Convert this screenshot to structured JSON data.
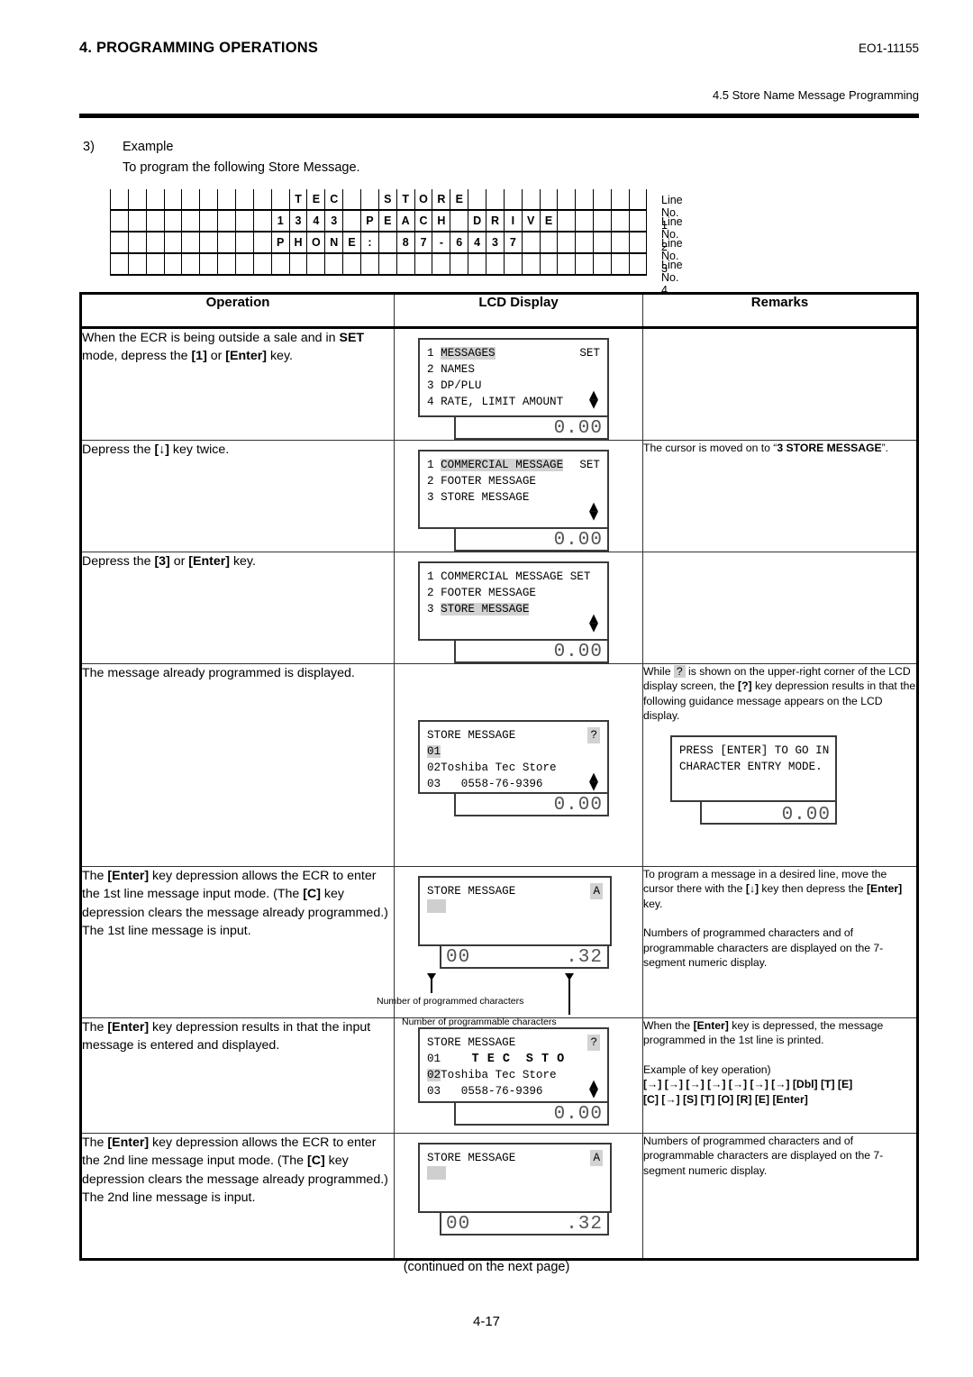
{
  "header": {
    "chapter_title": "4. PROGRAMMING OPERATIONS",
    "doc_code": "EO1-11155",
    "section": "4.5 Store Name Message Programming"
  },
  "intro": {
    "number": "3)",
    "line1": "Example",
    "line2": "To program the following Store Message."
  },
  "message_grid": {
    "columns": 30,
    "lines": [
      {
        "label": "Line No. 1",
        "cells": [
          "",
          "",
          "",
          "",
          "",
          "",
          "",
          "",
          "",
          "",
          "T",
          "E",
          "C",
          "",
          "",
          "S",
          "T",
          "O",
          "R",
          "E",
          "",
          "",
          "",
          "",
          "",
          "",
          "",
          "",
          "",
          ""
        ]
      },
      {
        "label": "Line No. 2",
        "cells": [
          "",
          "",
          "",
          "",
          "",
          "",
          "",
          "",
          "",
          "1",
          "3",
          "4",
          "3",
          "",
          "P",
          "E",
          "A",
          "C",
          "H",
          "",
          "D",
          "R",
          "I",
          "V",
          "E",
          "",
          "",
          "",
          "",
          ""
        ]
      },
      {
        "label": "Line No. 3",
        "cells": [
          "",
          "",
          "",
          "",
          "",
          "",
          "",
          "",
          "",
          "P",
          "H",
          "O",
          "N",
          "E",
          ":",
          "",
          "8",
          "7",
          "-",
          "6",
          "4",
          "3",
          "7",
          "",
          "",
          "",
          "",
          "",
          "",
          ""
        ]
      },
      {
        "label": "Line No. 4",
        "cells": [
          "",
          "",
          "",
          "",
          "",
          "",
          "",
          "",
          "",
          "",
          "",
          "",
          "",
          "",
          "",
          "",
          "",
          "",
          "",
          "",
          "",
          "",
          "",
          "",
          "",
          "",
          "",
          "",
          "",
          ""
        ]
      }
    ]
  },
  "table": {
    "headers": {
      "operation": "Operation",
      "lcd": "LCD Display",
      "remarks": "Remarks"
    },
    "rows": [
      {
        "operation_html": "When the ECR is being outside a sale and in <b>SET</b> mode, depress the <b>[1]</b> or <b>[Enter]</b> key.",
        "lcd": {
          "lines": [
            {
              "num": "1",
              "text": "MESSAGES",
              "highlight": true,
              "right": "SET"
            },
            {
              "num": "2",
              "text": "NAMES"
            },
            {
              "num": "3",
              "text": "DP/PLU"
            },
            {
              "num": "4",
              "text": "RATE, LIMIT AMOUNT",
              "arrows": true
            }
          ],
          "numeric_right": "0.00"
        },
        "remarks_html": ""
      },
      {
        "operation_html": "Depress the <b>[↓]</b> key twice.",
        "lcd": {
          "lines": [
            {
              "num": "1",
              "text": "COMMERCIAL MESSAGE",
              "highlight": true,
              "right": "SET"
            },
            {
              "num": "2",
              "text": "FOOTER MESSAGE"
            },
            {
              "num": "3",
              "text": "STORE MESSAGE"
            },
            {
              "num": "",
              "text": "",
              "arrows": true
            }
          ],
          "numeric_right": "0.00"
        },
        "remarks_html": "The cursor is moved on to “<b>3 STORE MESSAGE</b>”."
      },
      {
        "operation_html": "Depress the <b>[3]</b> or <b>[Enter]</b> key.",
        "lcd": {
          "lines": [
            {
              "num": "1",
              "text": "COMMERCIAL MESSAGE SET"
            },
            {
              "num": "2",
              "text": "FOOTER MESSAGE"
            },
            {
              "num": "3",
              "text": "STORE MESSAGE",
              "highlight": true
            },
            {
              "num": "",
              "text": "",
              "arrows": true
            }
          ],
          "numeric_right": "0.00"
        },
        "remarks_html": ""
      },
      {
        "operation_html": "The message already programmed is displayed.",
        "lcd": {
          "title": "STORE MESSAGE",
          "corner": "?",
          "lines": [
            {
              "num": "01",
              "text": "",
              "num_highlight": true
            },
            {
              "num": "02",
              "text": "Toshiba Tec Store"
            },
            {
              "num": "03",
              "text": "   0558-76-9396",
              "arrows": true
            }
          ],
          "numeric_right": "0.00"
        },
        "remarks_html": "While <span class=\"inl-hl\">?</span> is shown on the upper-right corner of the LCD display screen, the <b>[?]</b> key depression results in that the following guidance message appears on the LCD display.",
        "remarks_sub_lcd": {
          "lines": [
            "PRESS [ENTER] TO GO IN",
            "CHARACTER ENTRY MODE."
          ],
          "numeric_right": "0.00"
        }
      },
      {
        "operation_html": "The <b>[Enter]</b> key depression allows the ECR to enter the 1st line message input mode.  (The <b>[C]</b> key depression clears the message already programmed.)  The 1st line message is input.",
        "lcd": {
          "title": "STORE MESSAGE",
          "corner": "A",
          "cursor_block": true,
          "numeric_left": "00",
          "numeric_right": ".32",
          "annot_left": "Number of programmed characters",
          "annot_right": "Number of programmable characters"
        },
        "remarks_html": "To program a message in a desired line, move the cursor there with the <b>[↓]</b> key then depress the <b>[Enter]</b> key.<br><br>Numbers of programmed characters and of programmable characters are displayed on the 7-segment numeric display."
      },
      {
        "operation_html": "The <b>[Enter]</b> key depression results in that the input message is entered and displayed.",
        "lcd": {
          "title": "STORE MESSAGE",
          "corner": "?",
          "lines": [
            {
              "num": "01",
              "text": "    T E C  S T O",
              "bold": true
            },
            {
              "num": "02",
              "text": "Toshiba Tec Store",
              "num_highlight": true
            },
            {
              "num": "03",
              "text": "   0558-76-9396",
              "arrows": true
            }
          ],
          "numeric_right": "0.00"
        },
        "remarks_html": "When the <b>[Enter]</b> key is depressed, the message programmed in the 1st line is printed.<br><br>Example of key operation)<br><b>[→] [→] [→] [→] [→] [→] [→] [Dbl] [T] [E]<br>[C] [→] [S] [T] [O] [R] [E] [Enter]</b>"
      },
      {
        "operation_html": "The <b>[Enter]</b> key depression allows the ECR to enter the 2nd line message input mode.  (The <b>[C]</b> key depression clears the message already programmed.)  The 2nd line message is input.",
        "lcd": {
          "title": "STORE MESSAGE",
          "corner": "A",
          "cursor_block": true,
          "numeric_left": "00",
          "numeric_right": ".32"
        },
        "remarks_html": "Numbers of programmed characters and of programmable characters are displayed on the 7-segment numeric display."
      }
    ]
  },
  "footer": {
    "continued": "(continued on the next page)",
    "page_number": "4-17"
  }
}
